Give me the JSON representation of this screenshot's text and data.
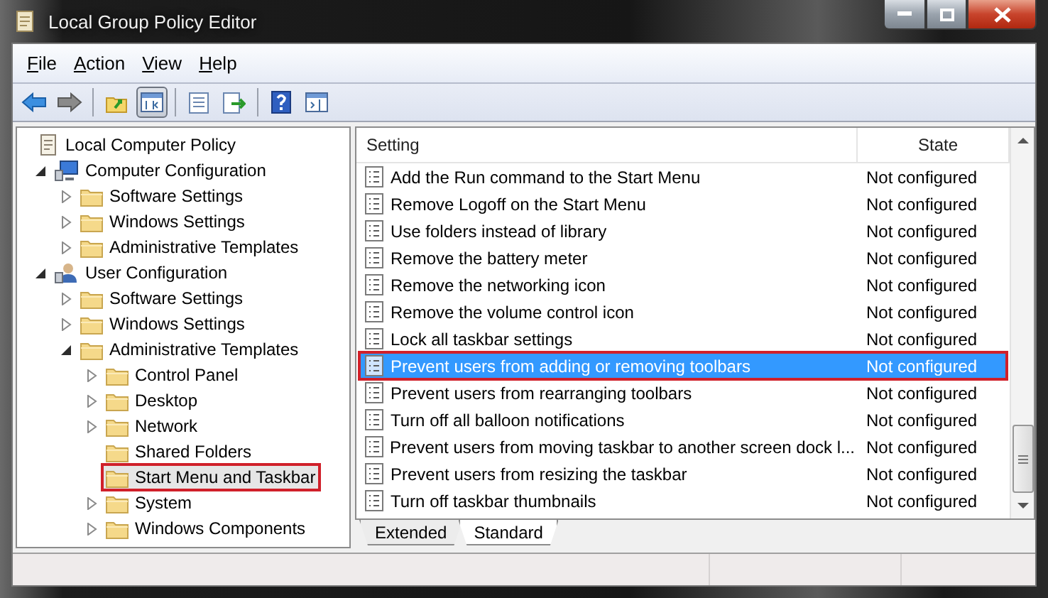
{
  "window": {
    "title": "Local Group Policy Editor"
  },
  "menu": [
    {
      "label": "File"
    },
    {
      "label": "Action"
    },
    {
      "label": "View"
    },
    {
      "label": "Help"
    }
  ],
  "toolbar": [
    {
      "kind": "back",
      "pressed": false
    },
    {
      "kind": "forward",
      "pressed": false
    },
    {
      "kind": "sep"
    },
    {
      "kind": "up",
      "pressed": false
    },
    {
      "kind": "tree",
      "pressed": true
    },
    {
      "kind": "sep"
    },
    {
      "kind": "list",
      "pressed": false
    },
    {
      "kind": "export",
      "pressed": false
    },
    {
      "kind": "sep"
    },
    {
      "kind": "help",
      "pressed": false
    },
    {
      "kind": "pane",
      "pressed": false
    }
  ],
  "tree": [
    {
      "label": "Local Computer Policy",
      "kind": "policy",
      "selected": false,
      "highlighted": false,
      "children": [
        {
          "label": "Computer Configuration",
          "kind": "computer",
          "expanded": true,
          "selected": false,
          "highlighted": false,
          "children": [
            {
              "label": "Software Settings",
              "kind": "folder",
              "expanded": false,
              "selected": false,
              "highlighted": false
            },
            {
              "label": "Windows Settings",
              "kind": "folder",
              "expanded": false,
              "selected": false,
              "highlighted": false
            },
            {
              "label": "Administrative Templates",
              "kind": "folder",
              "expanded": false,
              "selected": false,
              "highlighted": false
            }
          ]
        },
        {
          "label": "User Configuration",
          "kind": "user",
          "expanded": true,
          "selected": false,
          "highlighted": false,
          "children": [
            {
              "label": "Software Settings",
              "kind": "folder",
              "expanded": false,
              "selected": false,
              "highlighted": false
            },
            {
              "label": "Windows Settings",
              "kind": "folder",
              "expanded": false,
              "selected": false,
              "highlighted": false
            },
            {
              "label": "Administrative Templates",
              "kind": "folder",
              "expanded": true,
              "selected": false,
              "highlighted": false,
              "children": [
                {
                  "label": "Control Panel",
                  "kind": "folder",
                  "expanded": false,
                  "selected": false,
                  "highlighted": false
                },
                {
                  "label": "Desktop",
                  "kind": "folder",
                  "expanded": false,
                  "selected": false,
                  "highlighted": false
                },
                {
                  "label": "Network",
                  "kind": "folder",
                  "expanded": false,
                  "selected": false,
                  "highlighted": false
                },
                {
                  "label": "Shared Folders",
                  "kind": "folder",
                  "selected": false,
                  "highlighted": false
                },
                {
                  "label": "Start Menu and Taskbar",
                  "kind": "folder",
                  "selected": true,
                  "highlighted": true
                },
                {
                  "label": "System",
                  "kind": "folder",
                  "expanded": false,
                  "selected": false,
                  "highlighted": false
                },
                {
                  "label": "Windows Components",
                  "kind": "folder",
                  "expanded": false,
                  "selected": false,
                  "highlighted": false
                }
              ]
            }
          ]
        }
      ]
    }
  ],
  "table": {
    "columns": [
      "Setting",
      "State"
    ],
    "rows": [
      {
        "setting": "Add the Run command to the Start Menu",
        "state": "Not configured",
        "selected": false,
        "highlighted": false
      },
      {
        "setting": "Remove Logoff on the Start Menu",
        "state": "Not configured",
        "selected": false,
        "highlighted": false
      },
      {
        "setting": "Use folders instead of library",
        "state": "Not configured",
        "selected": false,
        "highlighted": false
      },
      {
        "setting": "Remove the battery meter",
        "state": "Not configured",
        "selected": false,
        "highlighted": false
      },
      {
        "setting": "Remove the networking icon",
        "state": "Not configured",
        "selected": false,
        "highlighted": false
      },
      {
        "setting": "Remove the volume control icon",
        "state": "Not configured",
        "selected": false,
        "highlighted": false
      },
      {
        "setting": "Lock all taskbar settings",
        "state": "Not configured",
        "selected": false,
        "highlighted": false
      },
      {
        "setting": "Prevent users from adding or removing toolbars",
        "state": "Not configured",
        "selected": true,
        "highlighted": true
      },
      {
        "setting": "Prevent users from rearranging toolbars",
        "state": "Not configured",
        "selected": false,
        "highlighted": false
      },
      {
        "setting": "Turn off all balloon notifications",
        "state": "Not configured",
        "selected": false,
        "highlighted": false
      },
      {
        "setting": "Prevent users from moving taskbar to another screen dock l...",
        "state": "Not configured",
        "selected": false,
        "highlighted": false
      },
      {
        "setting": "Prevent users from resizing the taskbar",
        "state": "Not configured",
        "selected": false,
        "highlighted": false
      },
      {
        "setting": "Turn off taskbar thumbnails",
        "state": "Not configured",
        "selected": false,
        "highlighted": false
      }
    ]
  },
  "tabs": [
    {
      "label": "Extended",
      "selected": false
    },
    {
      "label": "Standard",
      "selected": true
    }
  ]
}
